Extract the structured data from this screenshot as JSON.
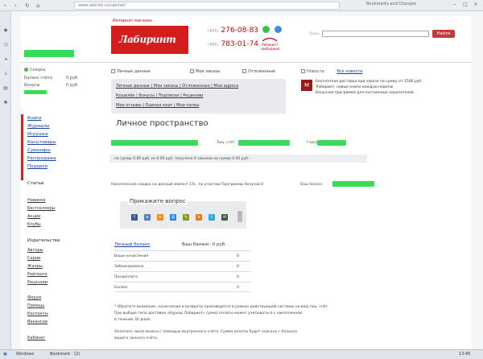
{
  "browser": {
    "back_glyph": "‹",
    "forward_glyph": "›",
    "refresh_glyph": "↻",
    "home_glyph": "⌂",
    "url": "www.labirint.ru/cabinet/",
    "right_text": "Bookmarks and Changes",
    "win_min": "–",
    "win_max": "□",
    "win_close": "×"
  },
  "header": {
    "store_caption": "Интернет-магазин",
    "logo_text": "Лабиринт",
    "phone1_prefix": "(495)",
    "phone1": "276-08-83",
    "phone2_prefix": "(495)",
    "phone2": "783-01-74",
    "partner_caption": "Лабиринт свободный",
    "search_label": "Поиск",
    "search_placeholder": "",
    "search_button": "Найти"
  },
  "user": {
    "status": "Скидка",
    "account_label": "Баланс счёта",
    "account_value": "0 руб.",
    "bonus_label": "Бонусы",
    "bonus_value": "0 руб."
  },
  "tabs": [
    {
      "label": "Личные данные"
    },
    {
      "label": "Мои заказы"
    },
    {
      "label": "Отложенные"
    }
  ],
  "nav_lines": [
    "Личные данные | Мои заказы | Отложенные | Мои адреса",
    "Кошелёк | Бонусы | Подписки | Рецензии",
    "Мои отзывы | Оценки книг | Мои полки"
  ],
  "news": {
    "header_label": "Новости",
    "header_link": "Все новости",
    "thumb_letter": "М",
    "lines": [
      "Бесплатная доставка при заказе на сумму от 1500 руб.",
      "Лабиринт: новые книги каждую неделю",
      "Бонусная программа для постоянных покупателей"
    ]
  },
  "left_nav": {
    "links": [
      "Книги",
      "Журналы",
      "Игрушки",
      "Канцтовары",
      "Сувениры",
      "Распродажа",
      "Подарки"
    ],
    "section1": "Статьи",
    "items1": [
      "Новинки",
      "Бестселлеры",
      "Акции",
      "Клубы"
    ],
    "section2": "Издательства",
    "items2": [
      "Авторы",
      "Серии",
      "Жанры",
      "Рейтинги",
      "Рецензии"
    ],
    "items3": [
      "Форум",
      "Помощь",
      "Контакты",
      "Вакансии"
    ],
    "bottom": "Кабинет"
  },
  "main": {
    "title": "Личное пространство",
    "label_account": "Лиц. счёт",
    "label_city": "Город",
    "strip_text": "на сумму 0.00 руб. из 0.00 руб. получено 0 заказов на сумму 0.00 руб.",
    "bonus_text": "Накопленная скидка на данный момент 1% , по участию Программы бонусов 0",
    "bonus_label_right": "Ваш баланс",
    "share_title": "Прикажите вопрос",
    "summary_title": "Личный баланс",
    "summary_balance": "Ваш баланс: 0 руб.",
    "summary_rows": [
      {
        "label": "Ваши начисления",
        "value": "0"
      },
      {
        "label": "Заблокировано",
        "value": "0"
      },
      {
        "label": "Предоплата",
        "value": "0"
      },
      {
        "label": "Баланс",
        "value": "0"
      }
    ],
    "footnotes": [
      "* Обратите внимание: начисления и возвраты производятся в рамках действующей системы на ваш лиц. счёт.",
      "При выборе типа доставки «Курьер Лабиринт» сумма оплаты может учитываться с накопленной",
      "в течение 30 дней.",
      "Оплатить заказ можно с помощью внутреннего счёта. Сумма оплаты будет списана с баланса",
      "вашего личного счёта."
    ]
  },
  "taskbar": {
    "start": "▣",
    "item1": "Windows",
    "item2": "Bookmark",
    "item3": "(2)",
    "clock": "13:45"
  },
  "colors": {
    "brand_red": "#d41e1e",
    "redaction_green": "#3ad957",
    "link_blue": "#1b3fa6"
  }
}
